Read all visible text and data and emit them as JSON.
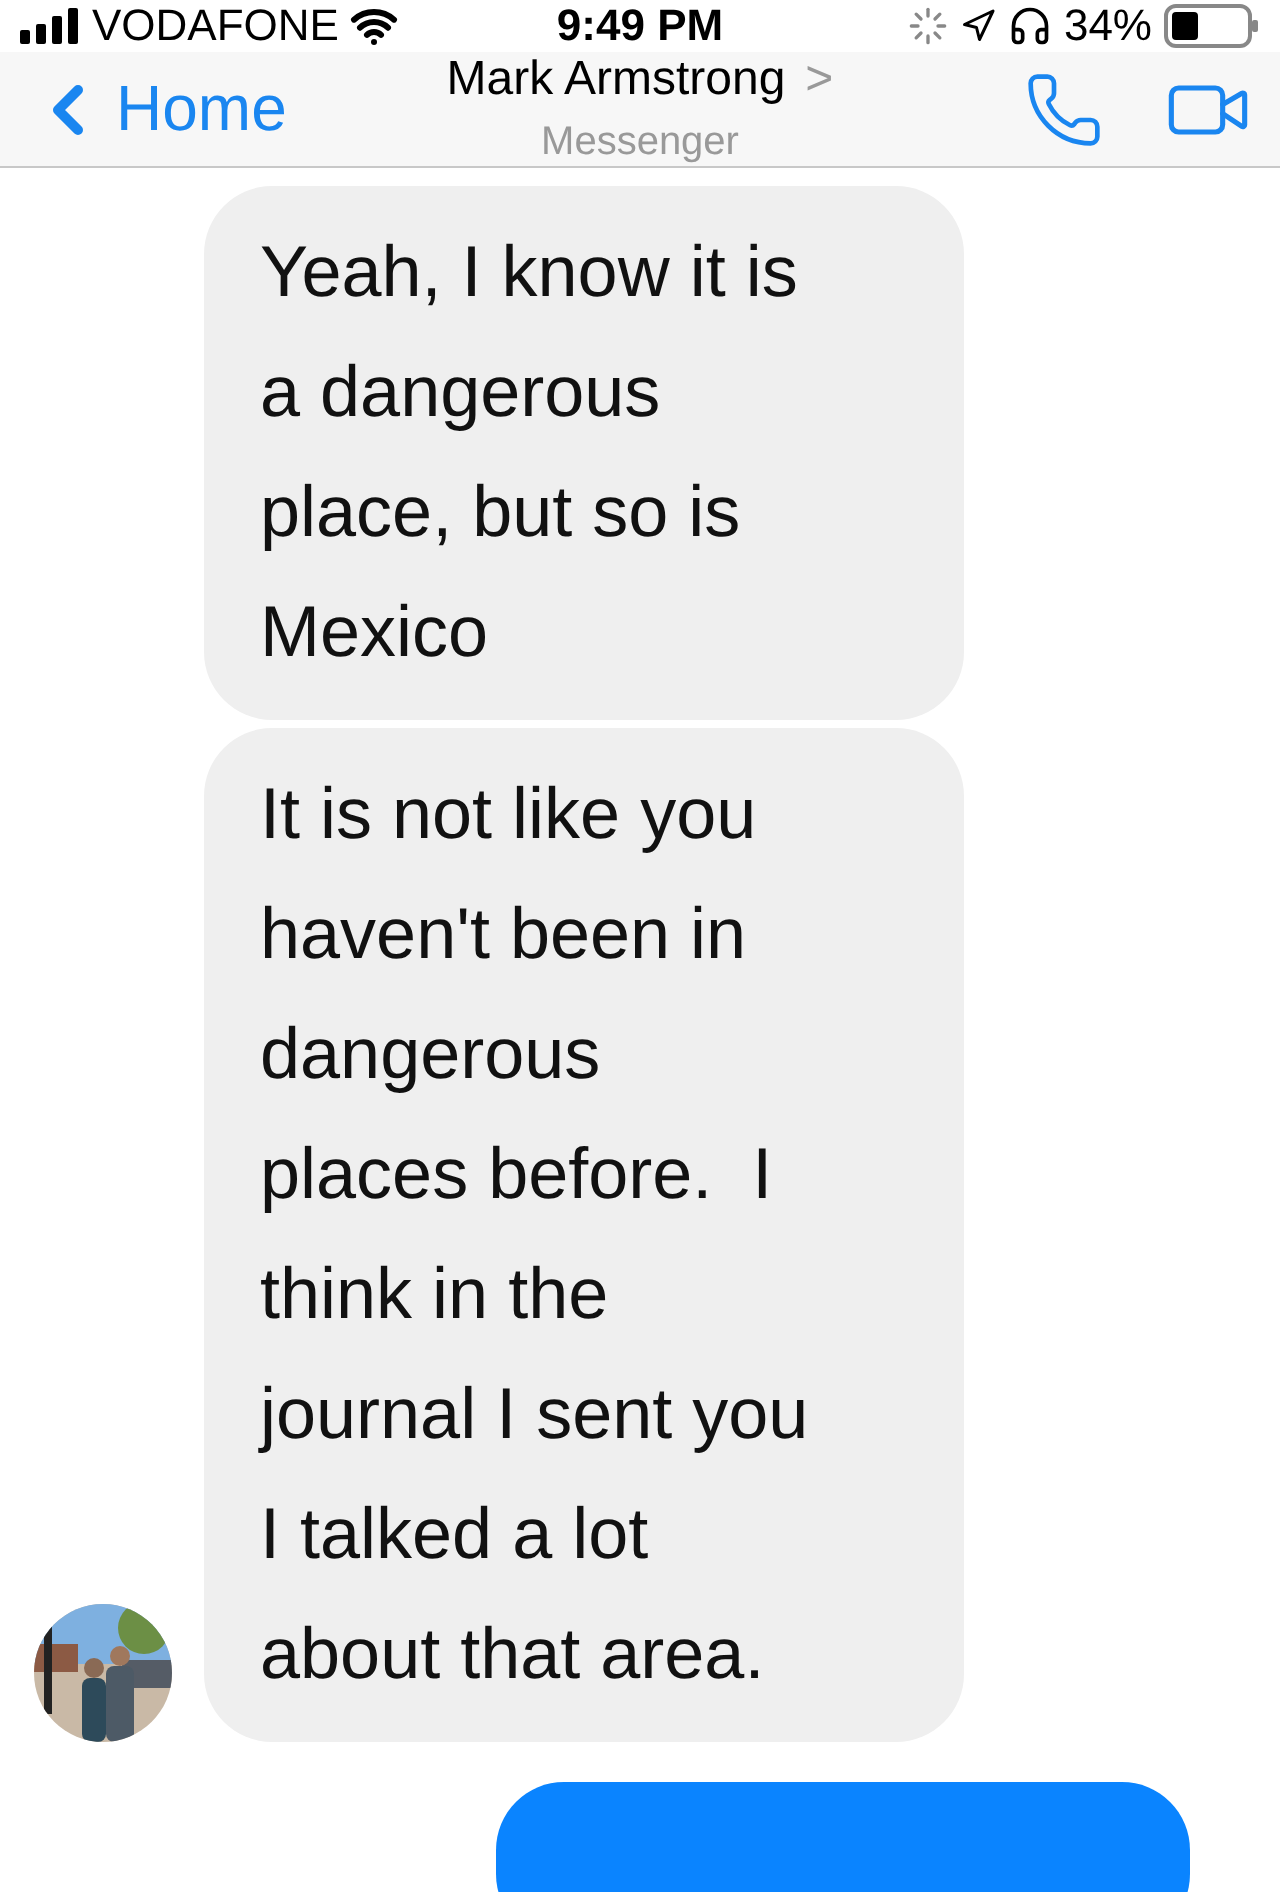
{
  "status_bar": {
    "carrier": "VODAFONE",
    "time": "9:49 PM",
    "battery": "34%"
  },
  "header": {
    "back": "Home",
    "title": "Mark Armstrong",
    "chevron": ">",
    "subtitle": "Messenger"
  },
  "messages": [
    {
      "kind": "incoming",
      "text": "Yeah, I know it is\na dangerous\nplace, but so is\nMexico",
      "avatar": false
    },
    {
      "kind": "incoming",
      "text": "It is not like you\nhaven't been in\ndangerous\nplaces before.  I\nthink in the\njournal I sent you\nI talked a lot\nabout that area.",
      "avatar": true
    },
    {
      "kind": "outgoing"
    }
  ]
}
